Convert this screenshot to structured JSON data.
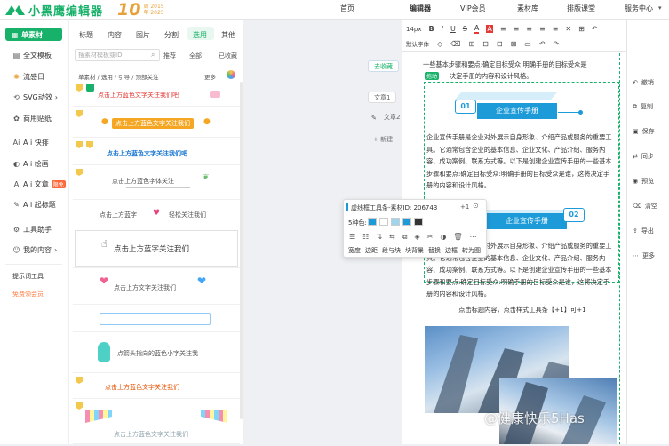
{
  "app": {
    "name": "小黑鹰编辑器",
    "anniv_big": "10",
    "anniv_small1": "周 2015",
    "anniv_small2": "年 2025"
  },
  "nav": [
    "首页",
    "编辑器",
    "VIP会员",
    "素材库",
    "排版课堂",
    "服务中心"
  ],
  "rail": {
    "active": "单素材",
    "items": [
      {
        "label": "全文模板",
        "icon": "▤"
      },
      {
        "label": "流感日",
        "icon": "✺"
      },
      {
        "label": "SVG动效",
        "icon": "⟲"
      },
      {
        "label": "商用贴纸",
        "icon": "✿"
      },
      {
        "label": "A i 快排",
        "icon": "Ai"
      },
      {
        "label": "A i 绘画",
        "icon": "◐"
      },
      {
        "label": "A i 文章",
        "icon": "A",
        "tag": "限免"
      },
      {
        "label": "A i 起标题",
        "icon": "✎"
      },
      {
        "label": "工具助手",
        "icon": "⚙"
      },
      {
        "label": "我的内容",
        "icon": "☺"
      }
    ],
    "bottom1": "提示词工具",
    "bottom2": "免费领会员"
  },
  "panel": {
    "tabs": [
      "标题",
      "内容",
      "图片",
      "分割",
      "选用",
      "其他"
    ],
    "selected_tab": "选用",
    "search_placeholder": "搜素材模板或ID",
    "filters": [
      "推荐",
      "全部",
      "已收藏"
    ],
    "breadcrumb": "单素材 / 选用 / 引导 / 顶部关注",
    "more": "更多",
    "cards": [
      "点击上方蓝色文字关注我们吧",
      "点击上方蓝色文字关注我们",
      "点击上方蓝色文字关注我们吧",
      "点击上方蓝色字体关注",
      "点击上方蓝字",
      "轻松关注我们",
      "点击上方蓝字关注我们",
      "点击上方文字关注我们",
      "点箭头指向的蓝色小字关注我",
      "点击上方蓝色文字关注我们",
      "点击上方蓝色文字关注我们"
    ]
  },
  "canvas": {
    "doc_tabs": [
      "去收藏",
      "文章1",
      "文章2",
      "+ 新建"
    ]
  },
  "toolbar": {
    "fontsize": "14px",
    "row1": [
      "B",
      "I",
      "U",
      "S",
      "A",
      "A",
      "≡",
      "≡",
      "≡",
      "≡",
      "≡",
      "✕",
      "⊞",
      "↶"
    ],
    "row2": [
      "默认字体",
      "◇",
      "⌫",
      "⊞",
      "⊟",
      "⊡",
      "⊠",
      "▭",
      "↶",
      "↷"
    ]
  },
  "doc": {
    "intro_line": "一些基本步骤和要点:确定目标受众:明确手册的目标受众是",
    "intro_line2": "决定手册的内容和设计风格。",
    "move_tag": "拖动",
    "banner_num1": "01",
    "banner_title": "企业宣传手册",
    "banner_num2": "02",
    "para1": "企业宣传手册是企业对外展示自身形象、介绍产品或服务的重要工具。它通常包含企业的基本信息、企业文化、产品介绍、服务内容、成功案例、联系方式等。以下是创建企业宣传手册的一些基本步骤和要点:确定目标受众:明确手册的目标受众是谁，这将决定手册的内容和设计风格。",
    "para2": "企业宣传手册是企业对外展示自身形象、介绍产品或服务的重要工具。它通常包含企业的基本信息、企业文化、产品介绍、服务内容、成功案例、联系方式等。以下是创建企业宣传手册的一些基本步骤和要点:确定目标受众:明确手册的目标受众是谁，这将决定手册的内容和设计风格。",
    "caption": "点击标题内容，点击样式工具条【+1】可+1"
  },
  "popup": {
    "title": "虚线框工具条-素材ID: 206743",
    "plus": "+1",
    "colors_label": "5种色:",
    "colors": [
      "#1d9bd8",
      "#ffffff",
      "#9fd4ef",
      "#1d9bd8",
      "#333333"
    ],
    "actions": [
      "宽度",
      "边距",
      "段与块",
      "块背景",
      "替换",
      "边框",
      "转为图"
    ]
  },
  "right": [
    "撤销",
    "复制",
    "保存",
    "同步",
    "预览",
    "清空",
    "导出",
    "更多"
  ],
  "watermark": "@健康快乐5Has"
}
